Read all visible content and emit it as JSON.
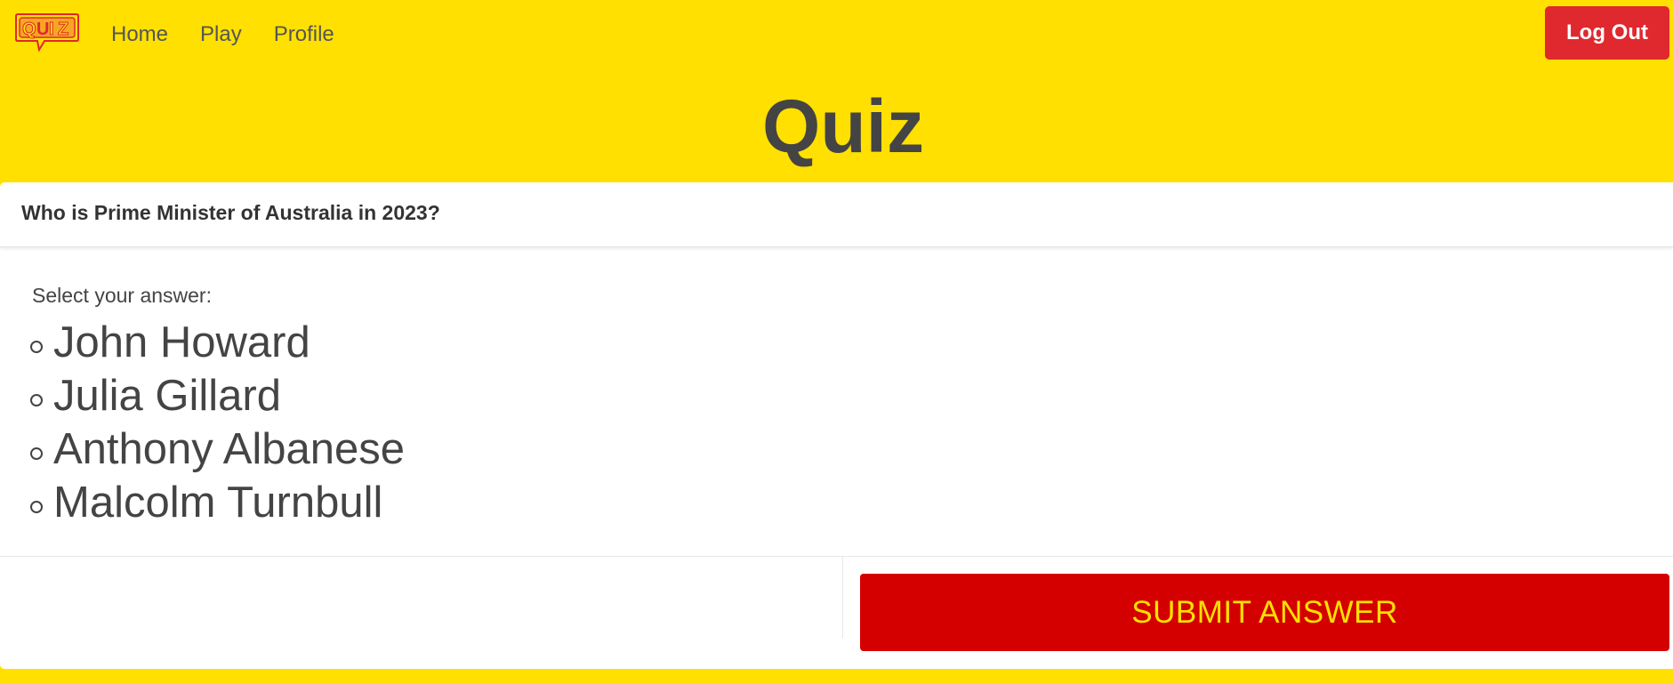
{
  "colors": {
    "background": "#FFE000",
    "logout_button": "#E0282F",
    "submit_button": "#D40000",
    "submit_text": "#FFE000",
    "text": "#444444"
  },
  "navbar": {
    "logo_text": "QUIZ",
    "links": [
      "Home",
      "Play",
      "Profile"
    ],
    "logout_label": "Log Out"
  },
  "page": {
    "title": "Quiz"
  },
  "quiz": {
    "question": "Who is Prime Minister of Australia in 2023?",
    "prompt": "Select your answer:",
    "answers": [
      "John Howard",
      "Julia Gillard",
      "Anthony Albanese",
      "Malcolm Turnbull"
    ],
    "submit_label": "SUBMIT ANSWER"
  }
}
